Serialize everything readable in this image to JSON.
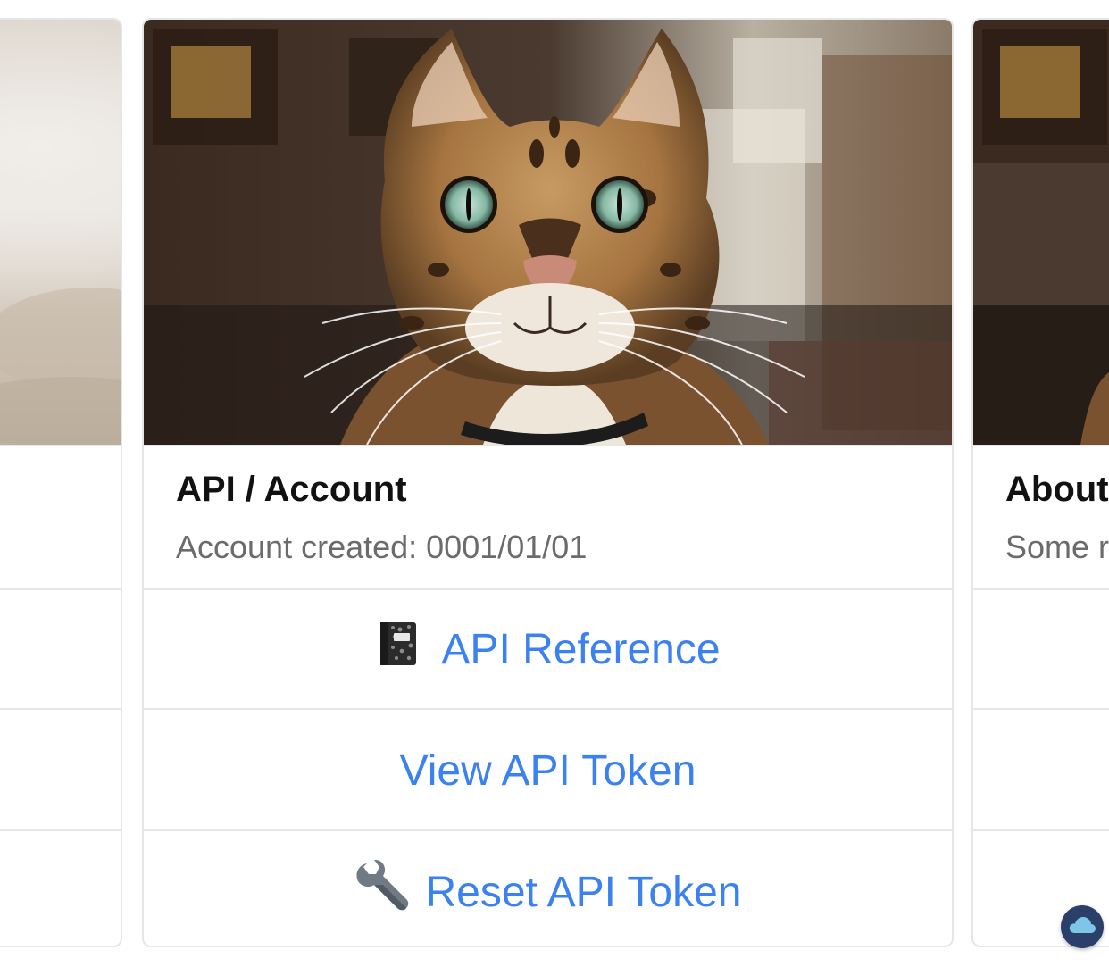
{
  "cards": {
    "left": {
      "image": "blurred-photo-beige"
    },
    "main": {
      "image": "bengal-cat-photo",
      "title": "API / Account",
      "subtitle": "Account created: 0001/01/01",
      "actions": [
        {
          "label": "API Reference",
          "icon": "notebook-icon"
        },
        {
          "label": "View API Token",
          "icon": ""
        },
        {
          "label": "Reset API Token",
          "icon": "wrench-icon"
        }
      ]
    },
    "right": {
      "image": "bengal-cat-photo",
      "title": "About",
      "subtitle": "Some r"
    }
  },
  "colors": {
    "link": "#3b82f0",
    "border": "#e6e6e9",
    "title": "#111111",
    "subtitle": "#6b6b6b",
    "badge": "#2b3f6b"
  },
  "badge": {
    "icon": "cloud-icon"
  }
}
